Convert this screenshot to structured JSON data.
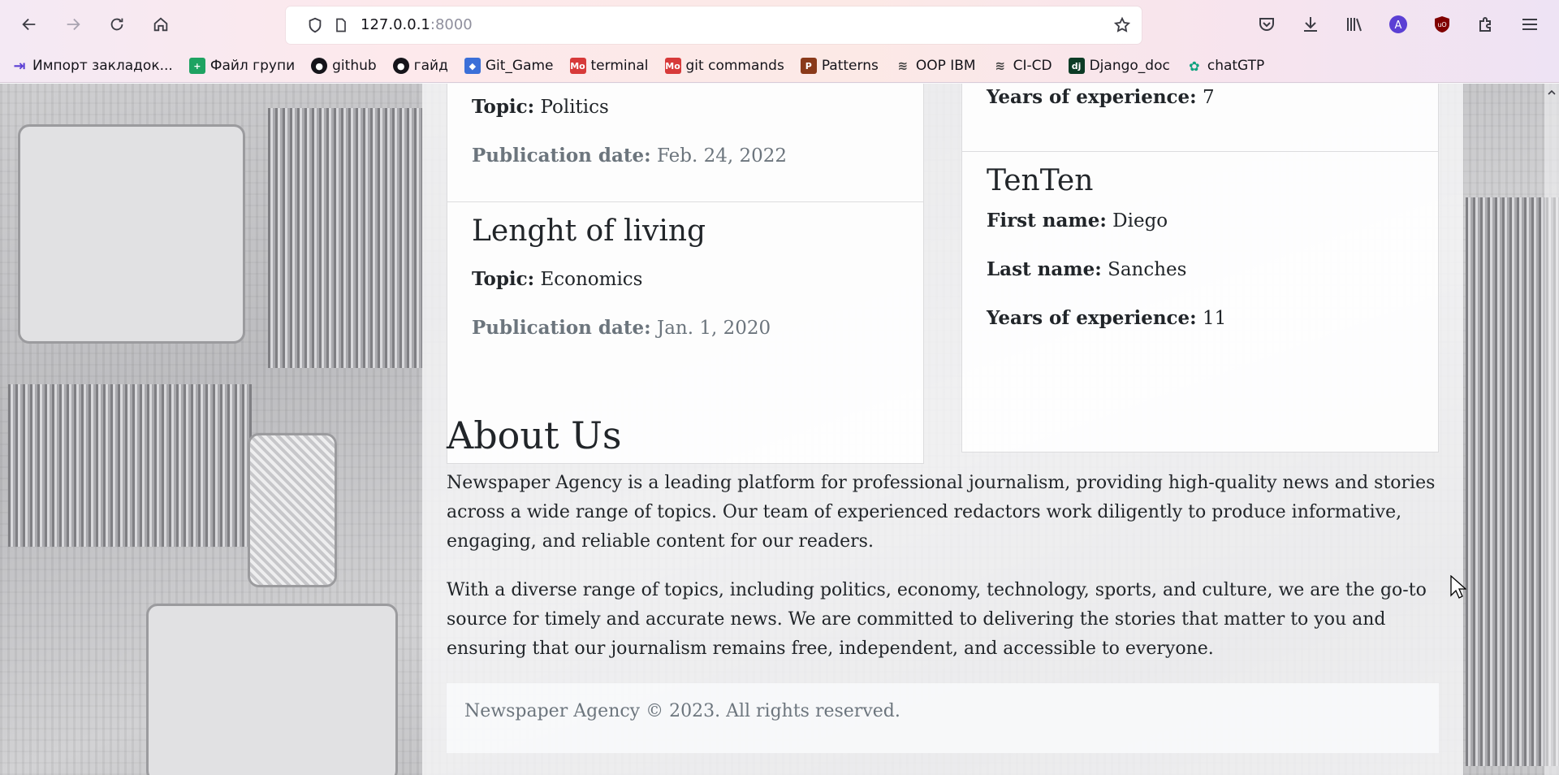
{
  "browser": {
    "url_host": "127.0.0.1",
    "url_port": ":8000",
    "bookmarks": [
      {
        "label": "Импорт закладок...",
        "icon": "import-icon",
        "color": "#5b3fd4"
      },
      {
        "label": "Файл групи",
        "icon": "sheets-icon",
        "color": "#1ea362"
      },
      {
        "label": "github",
        "icon": "github-icon",
        "color": "#15141a"
      },
      {
        "label": "гайд",
        "icon": "github-icon",
        "color": "#15141a"
      },
      {
        "label": "Git_Game",
        "icon": "git-game-icon",
        "color": "#3b6fd8"
      },
      {
        "label": "terminal",
        "icon": "mdn-icon",
        "color": "#d73a3a"
      },
      {
        "label": "git commands",
        "icon": "mdn-icon",
        "color": "#d73a3a"
      },
      {
        "label": "Patterns",
        "icon": "patterns-icon",
        "color": "#8a3a1a"
      },
      {
        "label": "OOP IBM",
        "icon": "ibm-icon",
        "color": "#444444"
      },
      {
        "label": "CI-CD",
        "icon": "ibm-icon",
        "color": "#444444"
      },
      {
        "label": "Django_doc",
        "icon": "django-icon",
        "color": "#0c3c26"
      },
      {
        "label": "chatGTP",
        "icon": "openai-icon",
        "color": "#10a37f"
      }
    ]
  },
  "newspapers": {
    "items": [
      {
        "topic_label": "Topic:",
        "topic": "Politics",
        "date_label": "Publication date:",
        "date": "Feb. 24, 2022"
      },
      {
        "title": "Lenght of living",
        "topic_label": "Topic:",
        "topic": "Economics",
        "date_label": "Publication date:",
        "date": "Jan. 1, 2020"
      }
    ]
  },
  "redactors": {
    "items": [
      {
        "exp_label": "Years of experience:",
        "exp": "7"
      },
      {
        "title": "TenTen",
        "first_label": "First name:",
        "first": "Diego",
        "last_label": "Last name:",
        "last": "Sanches",
        "exp_label": "Years of experience:",
        "exp": "11"
      }
    ]
  },
  "about": {
    "title": "About Us",
    "p1": "Newspaper Agency is a leading platform for professional journalism, providing high-quality news and stories across a wide range of topics. Our team of experienced redactors work diligently to produce informative, engaging, and reliable content for our readers.",
    "p2": "With a diverse range of topics, including politics, economy, technology, sports, and culture, we are the go-to source for timely and accurate news. We are committed to delivering the stories that matter to you and ensuring that our journalism remains free, independent, and accessible to everyone."
  },
  "footer": {
    "text": "Newspaper Agency © 2023. All rights reserved."
  },
  "colors": {
    "text": "#212529",
    "muted": "#6c757d",
    "accent": "#5b3fd4"
  }
}
